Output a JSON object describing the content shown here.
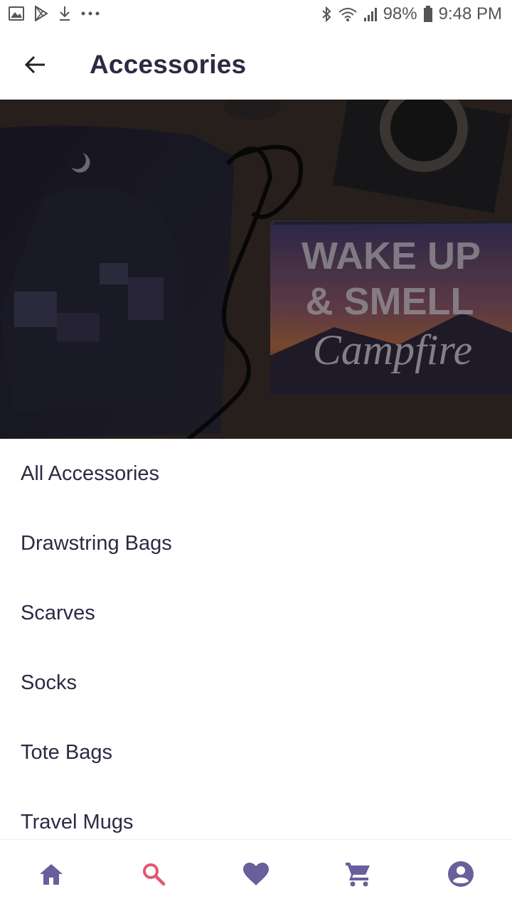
{
  "status_bar": {
    "battery": "98%",
    "time": "9:48 PM",
    "left_icons": [
      "image-icon",
      "play-store-icon",
      "download-icon",
      "more-icon"
    ],
    "right_icons": [
      "bluetooth-icon",
      "wifi-icon",
      "signal-icon",
      "battery-icon"
    ]
  },
  "app_bar": {
    "title": "Accessories",
    "back_icon": "arrow-left-icon"
  },
  "banner": {
    "text_lines": [
      "WAKE UP",
      "& SMELL",
      "Campfire"
    ]
  },
  "categories": [
    {
      "label": "All Accessories"
    },
    {
      "label": "Drawstring Bags"
    },
    {
      "label": "Scarves"
    },
    {
      "label": "Socks"
    },
    {
      "label": "Tote Bags"
    },
    {
      "label": "Travel Mugs"
    }
  ],
  "bottom_nav": {
    "active": "search",
    "items": [
      "home-icon",
      "search-icon",
      "heart-icon",
      "cart-icon",
      "account-icon"
    ]
  },
  "colors": {
    "primary": "#2b2a43",
    "nav_icon": "#6a5f9a",
    "active": "#e2566f"
  }
}
